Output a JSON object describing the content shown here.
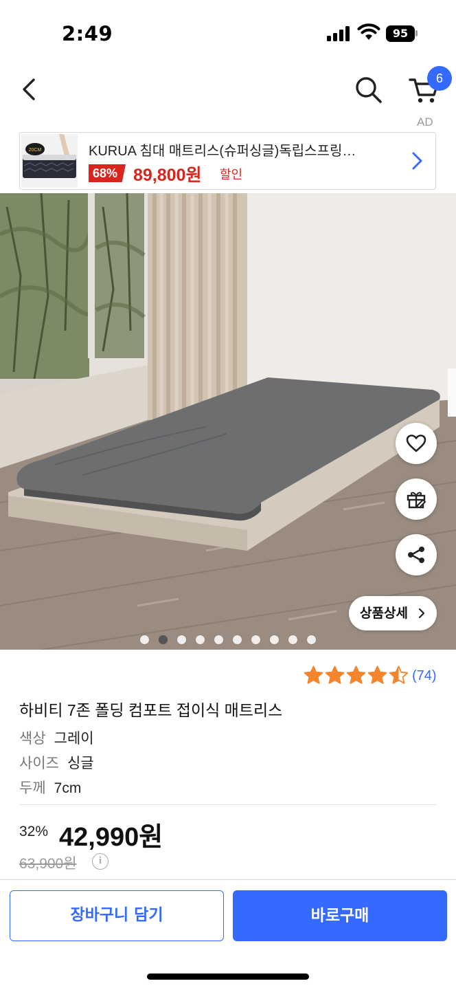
{
  "status_bar": {
    "time": "2:49",
    "battery": "95"
  },
  "nav": {
    "back_icon": "chevron-left-icon",
    "search_icon": "search-icon",
    "cart_icon": "cart-icon",
    "cart_count": "6"
  },
  "ad": {
    "label": "AD",
    "title": "KURUA 침대 매트리스(슈퍼싱글)독립스프링…",
    "discount": "68%",
    "price": "89,800원",
    "price_note": "할인",
    "thumb_badge": "20CM"
  },
  "hero": {
    "wishlist_icon": "heart-icon",
    "gift_icon": "gift-icon",
    "share_icon": "share-icon",
    "detail_label": "상품상세",
    "image_count": 10,
    "active_image_index": 1
  },
  "product": {
    "rating": 4.5,
    "rating_count": "(74)",
    "title": "하비티 7존 폴딩 컴포트 접이식 매트리스",
    "options": [
      {
        "key": "색상",
        "value": "그레이"
      },
      {
        "key": "사이즈",
        "value": "싱글"
      },
      {
        "key": "두께",
        "value": "7cm"
      }
    ],
    "discount_rate": "32%",
    "final_price": "42,990원",
    "original_price": "63,900원"
  },
  "actions": {
    "add_to_cart": "장바구니 담기",
    "buy_now": "바로구매"
  },
  "colors": {
    "accent": "#346aff",
    "ad_red": "#d8261f",
    "star": "#f5842b"
  }
}
